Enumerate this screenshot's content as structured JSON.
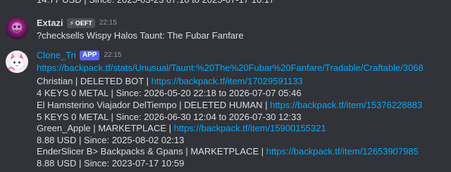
{
  "cut_line": "14.77 USD | Since: 2025-03-23 07:10 to 2025-07-17 16:17",
  "message1": {
    "author": "Extazi",
    "author_color": "#dbdee1",
    "badge": "OEFT",
    "time": "22:15",
    "text": "?checksells Wispy Halos Taunt: The Fubar Fanfare"
  },
  "message2": {
    "author": "Clone_Tri",
    "author_color": "#00a8fc",
    "badge": "APP",
    "time": "22:15",
    "url": "https://backpack.tf/stats/Unusual/Taunt:%20The%20Fubar%20Fanfare/Tradable/Craftable/3068",
    "entries": [
      {
        "seller": "Christian | DELETED BOT | ",
        "link": "https://backpack.tf/item/17029591133",
        "detail": "4 KEYS 0 METAL | Since: 2026-05-20 22:18 to 2026-07-07 05:46"
      },
      {
        "seller": "El Hamsterino Viajador DelTiempo | DELETED HUMAN | ",
        "link": "https://backpack.tf/item/15376228883",
        "detail": "5 KEYS 0 METAL | Since: 2026-06-30 12:04 to 2026-07-30 12:33"
      },
      {
        "seller": "Green_Apple | MARKETPLACE | ",
        "link": "https://backpack.tf/item/15900155321",
        "detail": "8.88 USD | Since: 2025-08-02 02:13"
      },
      {
        "seller": "EnderSlicer B> Backpacks & Gpans | MARKETPLACE | ",
        "link": "https://backpack.tf/item/12653907985",
        "detail": "8.88 USD | Since: 2023-07-17 10:59"
      }
    ]
  },
  "colors": {
    "background": "#313338",
    "text": "#dbdee1",
    "link": "#00a8fc",
    "timestamp": "#949ba4",
    "app_badge": "#5865f2"
  }
}
